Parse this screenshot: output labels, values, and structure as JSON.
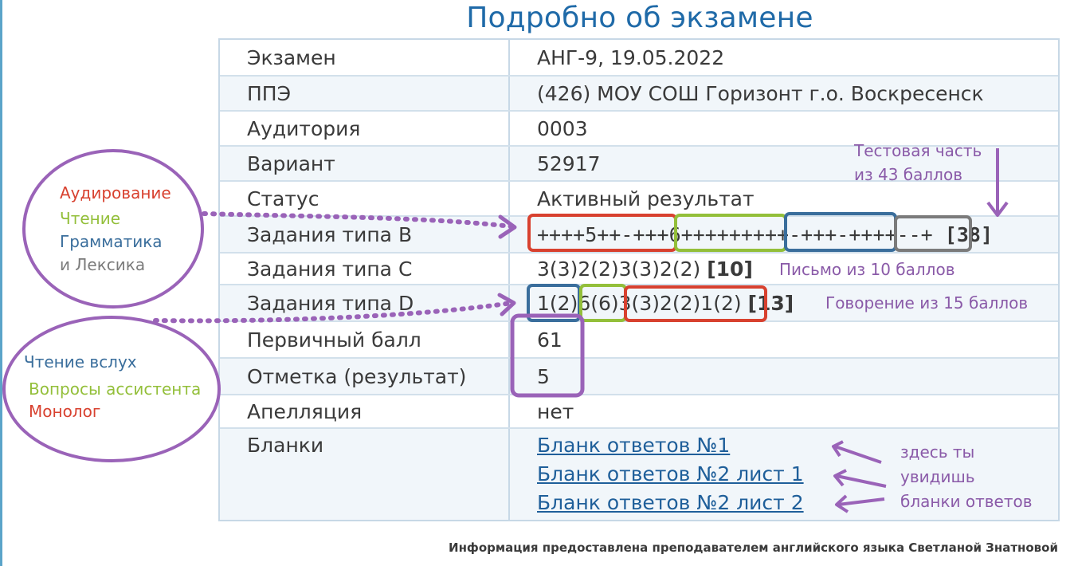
{
  "page_title": "Подробно об экзамене",
  "rows": [
    {
      "label": "Экзамен",
      "value": "АНГ-9, 19.05.2022"
    },
    {
      "label": "ППЭ",
      "value": "(426) МОУ СОШ Горизонт г.о. Воскресенск"
    },
    {
      "label": "Аудитория",
      "value": "0003"
    },
    {
      "label": "Вариант",
      "value": "52917"
    },
    {
      "label": "Статус",
      "value": "Активный результат"
    },
    {
      "label": "Задания типа B",
      "parts": [
        "++++5++-+++",
        "6+++++++",
        "++-+++-+",
        "+++--+"
      ],
      "score": "[38]"
    },
    {
      "label": "Задания типа C",
      "value": "3(3)2(2)3(3)2(2)",
      "score": "[10]"
    },
    {
      "label": "Задания типа D",
      "parts": [
        "1(2)",
        "6(6)",
        "3(3)2(2)1(2)"
      ],
      "score": "[13]"
    },
    {
      "label": "Первичный балл",
      "value": "61"
    },
    {
      "label": "Отметка (результат)",
      "value": "5"
    },
    {
      "label": "Апелляция",
      "value": "нет"
    },
    {
      "label": "Бланки",
      "links": [
        "Бланк ответов №1",
        "Бланк ответов №2 лист 1",
        "Бланк ответов №2 лист 2"
      ]
    }
  ],
  "annotations": {
    "test_part": [
      "Тестовая часть",
      "из 43 баллов"
    ],
    "letter": "Письмо из 10 баллов",
    "speaking": "Говорение из 15 баллов",
    "sections_b": [
      "Аудирование",
      "Чтение",
      "Грамматика",
      "и Лексика"
    ],
    "sections_d": [
      "Чтение вслух",
      "Вопросы ассистента",
      "Монолог"
    ],
    "blanks_note": [
      "здесь ты",
      "увидишь",
      "бланки ответов"
    ]
  },
  "footer": "Информация предоставлена преподавателем английского языка Светланой Знатновой",
  "colors": {
    "title": "#1f6aa8",
    "purple": "#8a5aa8",
    "red": "#d8412f",
    "green": "#93bf3a",
    "blue": "#3a6e9c",
    "gray": "#7b7b7b",
    "link": "#1f5f9a"
  }
}
